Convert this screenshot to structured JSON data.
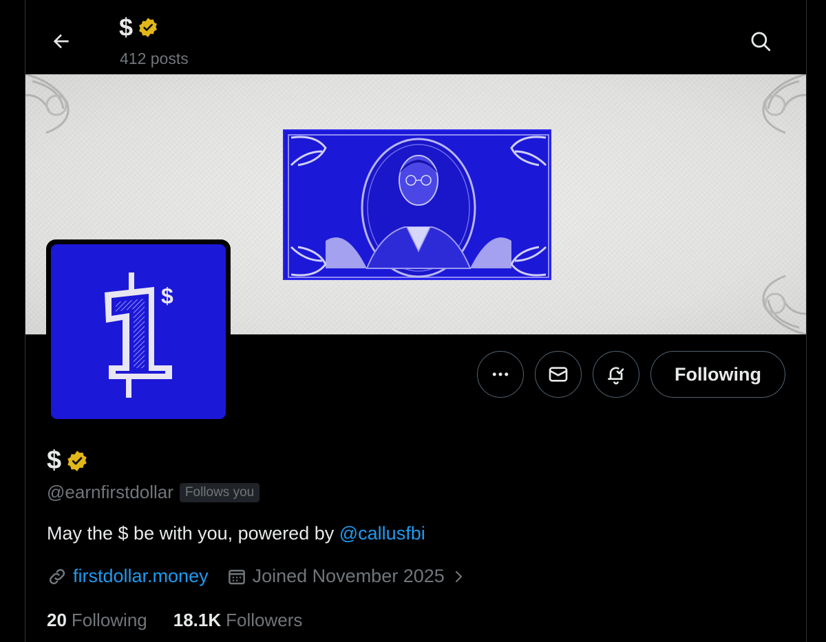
{
  "header": {
    "name": "$",
    "posts": "412 posts"
  },
  "profile": {
    "name": "$",
    "handle": "@earnfirstdollar",
    "follows_you": "Follows you",
    "bio_text": "May the $ be with you, powered by ",
    "bio_mention": "@callusfbi",
    "website": "firstdollar.money",
    "joined": "Joined November 2025",
    "following_count": "20",
    "following_label": "Following",
    "followers_count": "18.1K",
    "followers_label": "Followers"
  },
  "actions": {
    "following_button": "Following",
    "icons": [
      "more-icon",
      "message-icon",
      "notification-bell-icon"
    ]
  },
  "avatar": {
    "text": "$"
  },
  "colors": {
    "background": "#000000",
    "text_primary": "#e7e9ea",
    "text_secondary": "#71767b",
    "link": "#1d9bf0",
    "verified_gold": "#e2b719",
    "brand_blue": "#1c18d8",
    "border": "#536471"
  }
}
